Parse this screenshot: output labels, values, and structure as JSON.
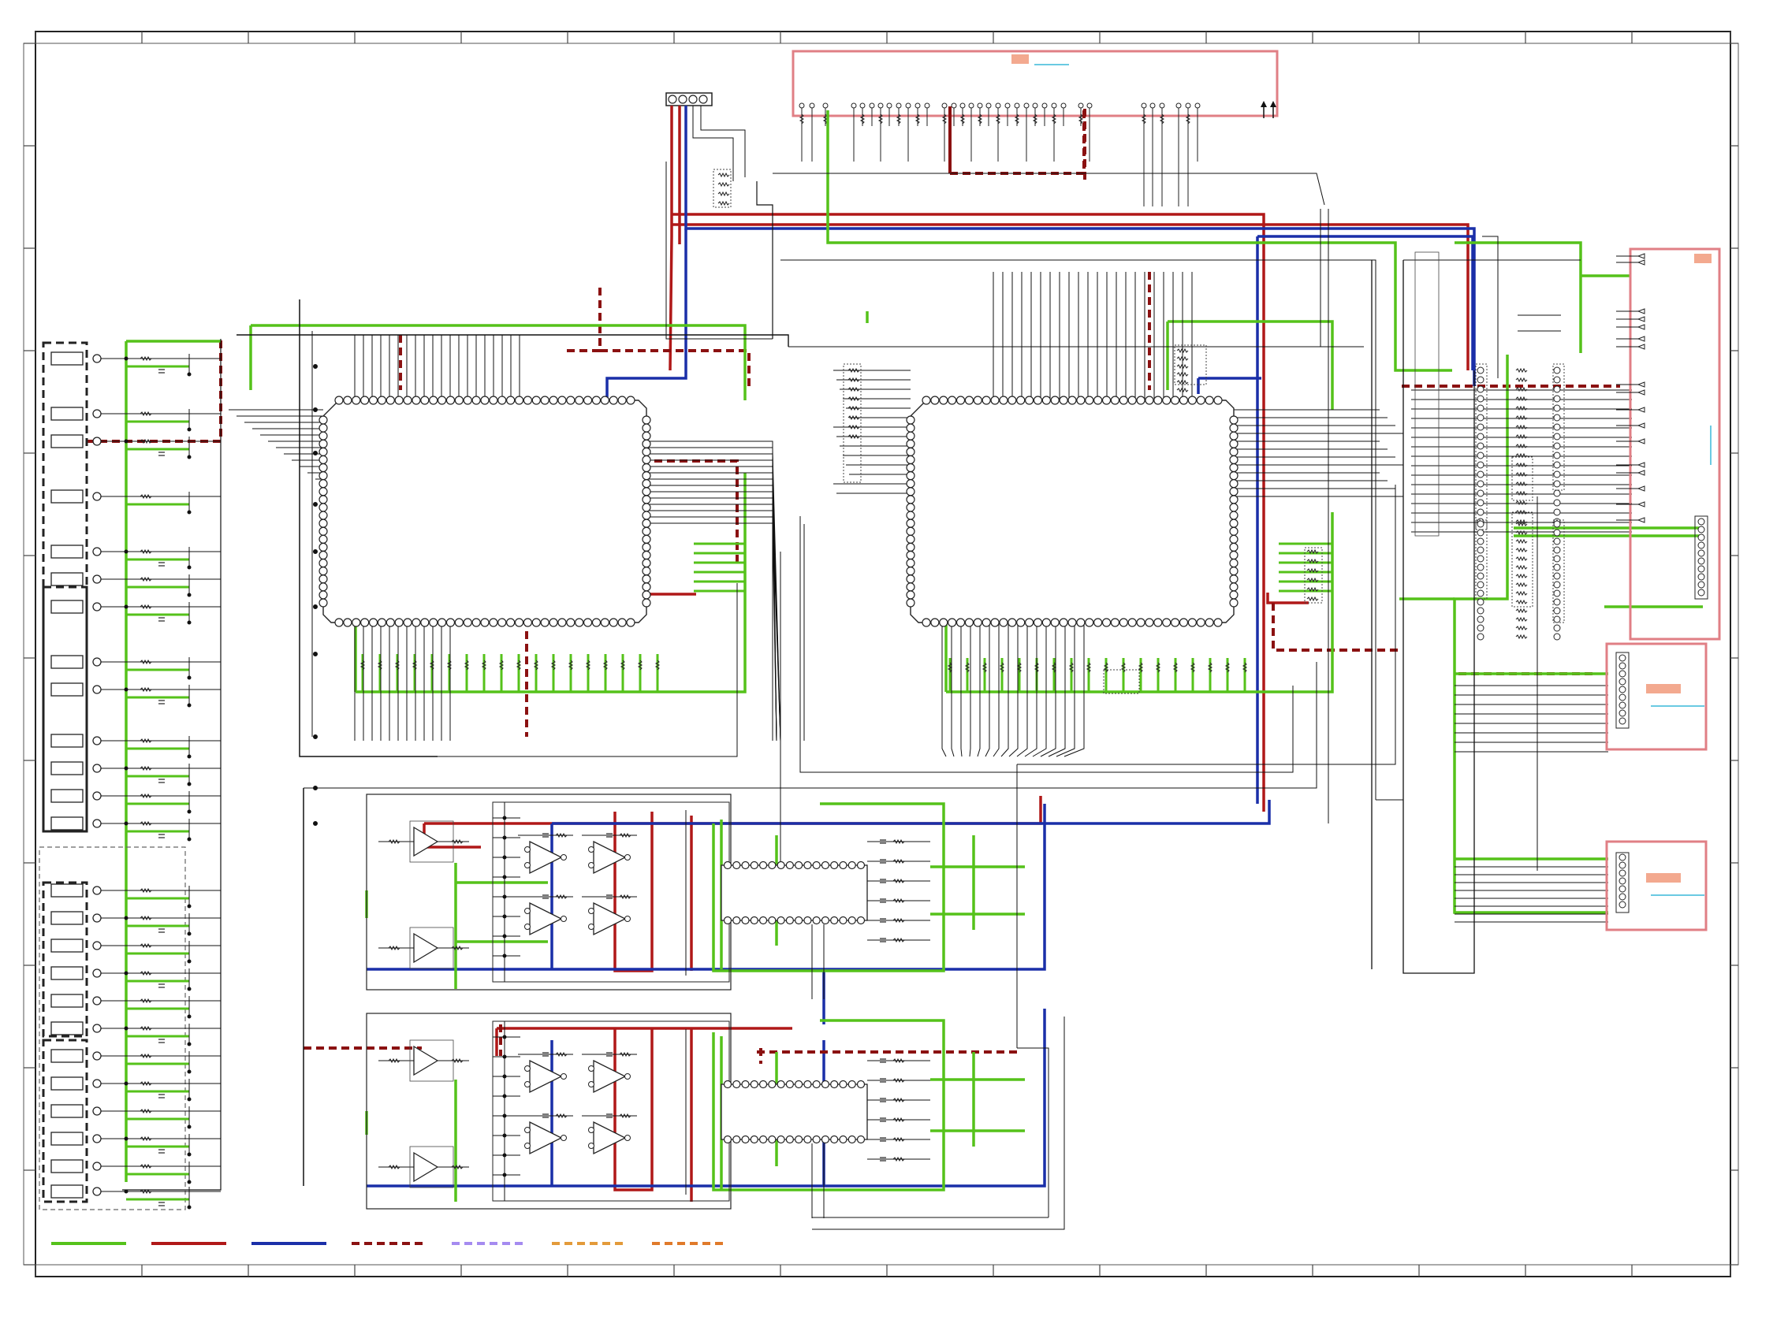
{
  "document": {
    "kind": "schematic",
    "colors": {
      "background": "#ffffff",
      "frame": "#222222",
      "signal": "#111111",
      "green_net": "#55c21a",
      "red_net": "#b01818",
      "blue_net": "#1a2fa8",
      "dashed_red_net": "#8b1111",
      "dashed_violet_net": "#a58bf0",
      "dashed_orange_net": "#e39a3a",
      "dashed_orange2_net": "#e07a2a",
      "highlight_box": "#e07f85",
      "label_fill": "#f3a98f",
      "cyan_note": "#38b8d8"
    },
    "legend": [
      {
        "key": "green-solid",
        "color": "#55c21a",
        "style": "solid"
      },
      {
        "key": "red-solid",
        "color": "#b01818",
        "style": "solid"
      },
      {
        "key": "blue-solid",
        "color": "#1a2fa8",
        "style": "solid"
      },
      {
        "key": "red-dashed",
        "color": "#8b1111",
        "style": "dashed"
      },
      {
        "key": "violet-dashed",
        "color": "#a58bf0",
        "style": "dashed"
      },
      {
        "key": "orange-dashed",
        "color": "#e39a3a",
        "style": "dashed"
      },
      {
        "key": "orange2-dashed",
        "color": "#e07a2a",
        "style": "dashed"
      }
    ],
    "connector_pins": 4,
    "qfp_pins_per_side": 22,
    "soic_pins_per_side": 16
  }
}
